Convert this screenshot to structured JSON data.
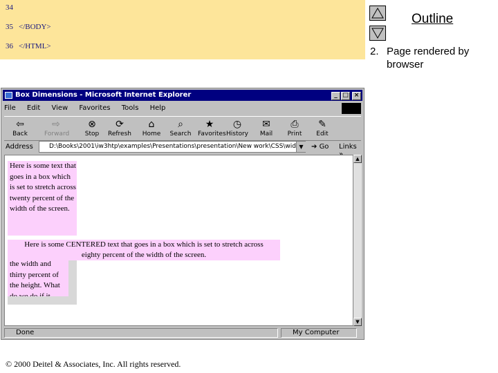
{
  "code": {
    "lines": [
      {
        "num": "34",
        "text": ""
      },
      {
        "num": "35",
        "text": "</BODY>"
      },
      {
        "num": "36",
        "text": "</HTML>"
      }
    ]
  },
  "sidebar": {
    "outline_title": "Outline",
    "item_number": "2.",
    "item_text_line1": "Page rendered by",
    "item_text_line2": "browser"
  },
  "browser": {
    "title": "Box Dimensions - Microsoft Internet Explorer",
    "menu": [
      "File",
      "Edit",
      "View",
      "Favorites",
      "Tools",
      "Help"
    ],
    "toolbar": [
      "Back",
      "Forward",
      "Stop",
      "Refresh",
      "Home",
      "Search",
      "Favorites",
      "History",
      "Mail",
      "Print",
      "Edit"
    ],
    "address_label": "Address",
    "address_value": "D:\\Books\\2001\\iw3htp\\examples\\Presentations\\presentation\\New work\\CSS\\width.html",
    "go_label": "Go",
    "links_label": "Links »",
    "status_left": "Done",
    "status_right": "My Computer"
  },
  "page": {
    "box1": "Here is some text that goes in a box which is set to stretch across twenty percent of the width of the screen.",
    "box2_line1": "Here is some CENTERED text that goes in a box which is set to stretch across",
    "box2_line2": "eighty percent of the width of the screen.",
    "box3": "the width and thirty percent of the height. What do we do if it"
  },
  "footer": {
    "text": "© 2000 Deitel & Associates, Inc.  All rights reserved."
  }
}
